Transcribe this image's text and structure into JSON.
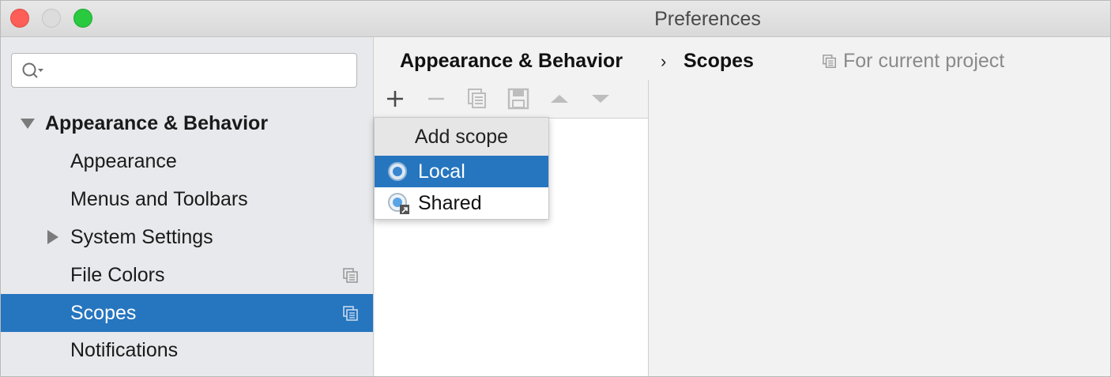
{
  "window": {
    "title": "Preferences"
  },
  "search": {
    "placeholder": "",
    "value": ""
  },
  "sidebar": {
    "items": [
      {
        "label": "Appearance & Behavior",
        "expanded": true,
        "bold": true
      },
      {
        "label": "Appearance"
      },
      {
        "label": "Menus and Toolbars"
      },
      {
        "label": "System Settings",
        "expandable": true
      },
      {
        "label": "File Colors",
        "project_icon": "project-scope-icon"
      },
      {
        "label": "Scopes",
        "selected": true,
        "project_icon": "project-scope-icon"
      },
      {
        "label": "Notifications"
      }
    ]
  },
  "header": {
    "breadcrumb_parent": "Appearance & Behavior",
    "breadcrumb_sep": "›",
    "breadcrumb_current": "Scopes",
    "for_current_project": "For current project"
  },
  "toolbar": {
    "buttons": [
      "add-icon",
      "remove-icon",
      "copy-icon",
      "save-icon",
      "move-up-icon",
      "move-down-icon"
    ]
  },
  "popup": {
    "header": "Add scope",
    "items": [
      {
        "label": "Local",
        "selected": true,
        "icon": "local-scope-icon"
      },
      {
        "label": "Shared",
        "icon": "shared-scope-icon"
      }
    ]
  },
  "colors": {
    "selection": "#2675bf",
    "sidebar_bg": "#e7e9ec",
    "panel_bg": "#f2f2f2"
  }
}
